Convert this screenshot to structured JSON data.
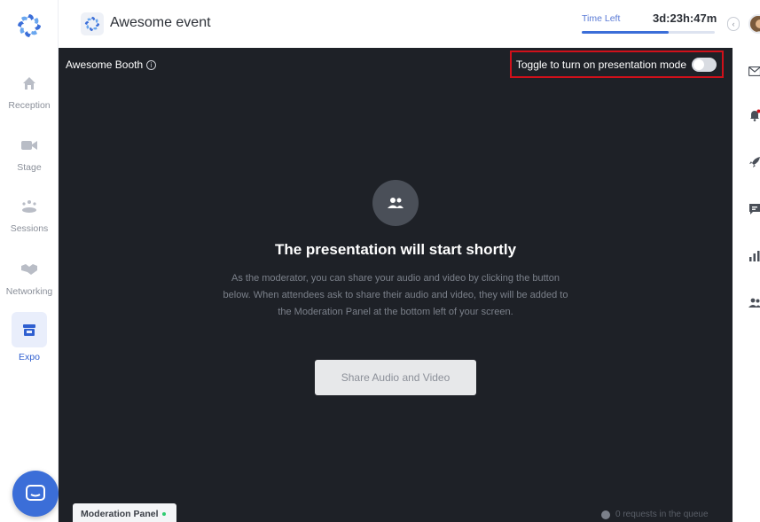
{
  "sidebar": {
    "items": [
      {
        "label": "Reception",
        "icon": "home-icon"
      },
      {
        "label": "Stage",
        "icon": "camera-icon"
      },
      {
        "label": "Sessions",
        "icon": "sessions-icon"
      },
      {
        "label": "Networking",
        "icon": "handshake-icon"
      },
      {
        "label": "Expo",
        "icon": "storefront-icon",
        "active": true
      }
    ]
  },
  "header": {
    "event_title": "Awesome event",
    "time_left_label": "Time Left",
    "time_left_value": "3d:23h:47m",
    "time_left_progress": 0.65
  },
  "stage": {
    "booth_name": "Awesome Booth",
    "toggle_label": "Toggle to turn on presentation mode",
    "toggle_on": false,
    "headline": "The presentation will start shortly",
    "description": "As the moderator, you can share your audio and video by clicking the button below. When attendees ask to share their audio and video, they will be added to the Moderation Panel at the bottom left of your screen.",
    "share_button": "Share Audio and Video",
    "moderation_panel_label": "Moderation Panel",
    "queue_text": "0 requests in the queue"
  },
  "colors": {
    "accent": "#3b6ed8",
    "stage_bg": "#1e2127",
    "highlight_border": "#d0101a"
  },
  "right_rail": {
    "icons": [
      "mail-icon",
      "bell-icon",
      "rocket-icon",
      "chat-icon",
      "poll-icon",
      "people-icon"
    ]
  }
}
